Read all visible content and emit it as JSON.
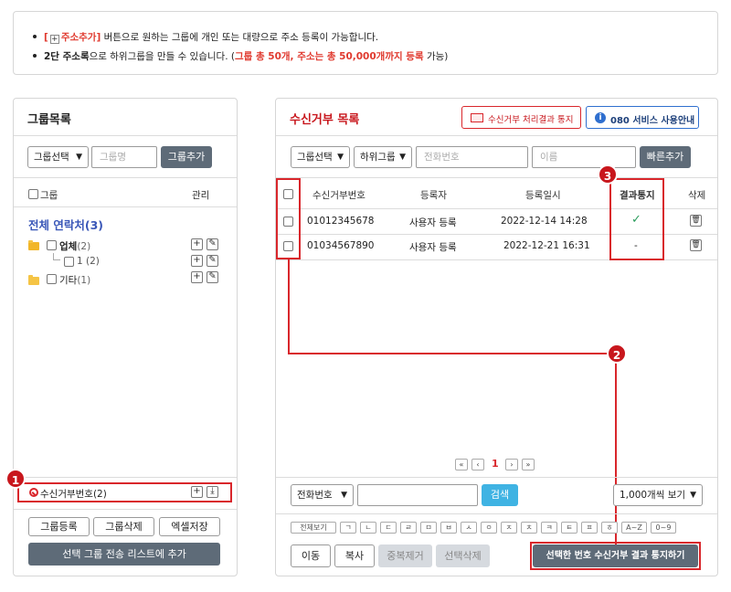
{
  "notice": {
    "line1_bracket_open": "[",
    "line1_btn_plus": "+",
    "line1_btn": "주소추가]",
    "line1_rest": " 버튼으로 원하는 그룹에 개인 또는 대량으로 주소 등록이 가능합니다.",
    "line2_bold": "2단 주소록",
    "line2_mid": "으로 하위그룹을 만들 수 있습니다. (",
    "line2_red": "그룹 총 50개, 주소는 총 50,000개까지 등록",
    "line2_end": " 가능)"
  },
  "left": {
    "title": "그룹목록",
    "group_select": "그룹선택",
    "group_name_placeholder": "그룹명",
    "add_group": "그룹추가",
    "col_group": "그룹",
    "col_manage": "관리",
    "all_contacts": "전체 연락처(3)",
    "groups": [
      {
        "name": "업체",
        "count": "(2)"
      },
      {
        "name": "1",
        "count": "(2)"
      },
      {
        "name": "기타",
        "count": "(1)"
      }
    ],
    "reject_number": "수신거부번호(2)",
    "btn_register": "그룹등록",
    "btn_delete": "그룹삭제",
    "btn_excel": "엑셀저장",
    "btn_add_list": "선택 그룹 전송 리스트에 추가"
  },
  "right": {
    "title": "수신거부 목록",
    "btn_notify_result": "수신거부 처리결과 통지",
    "btn_080": "080 서비스 사용안내",
    "group_select": "그룹선택",
    "subgroup": "하위그룹",
    "phone_placeholder": "전화번호",
    "name_placeholder": "이름",
    "quick_add": "빠른추가",
    "columns": [
      "수신거부번호",
      "등록자",
      "등록일시",
      "결과통지",
      "삭제"
    ],
    "rows": [
      {
        "number": "01012345678",
        "registrant": "사용자 등록",
        "date": "2022-12-14 14:28",
        "result": "✓"
      },
      {
        "number": "01034567890",
        "registrant": "사용자 등록",
        "date": "2022-12-21 16:31",
        "result": "-"
      }
    ],
    "pager": {
      "first": "«",
      "prev": "‹",
      "page": "1",
      "next": "›",
      "last": "»"
    },
    "search_field": "전화번호",
    "search_btn": "검색",
    "view_count": "1,000개씩 보기",
    "chars": [
      "전체보기",
      "ㄱ",
      "ㄴ",
      "ㄷ",
      "ㄹ",
      "ㅁ",
      "ㅂ",
      "ㅅ",
      "ㅇ",
      "ㅈ",
      "ㅊ",
      "ㅋ",
      "ㅌ",
      "ㅍ",
      "ㅎ",
      "A~Z",
      "0~9"
    ],
    "btn_move": "이동",
    "btn_copy": "복사",
    "btn_dedupe": "중복제거",
    "btn_del_sel": "선택삭제",
    "btn_notify_sel": "선택한 번호 수신거부 결과 통지하기"
  },
  "badges": [
    "1",
    "2",
    "3"
  ],
  "colors": {
    "accent_red": "#d9262b",
    "title_red": "#c8171d",
    "link_blue": "#3a57b8",
    "dark_btn": "#5e6b78"
  }
}
